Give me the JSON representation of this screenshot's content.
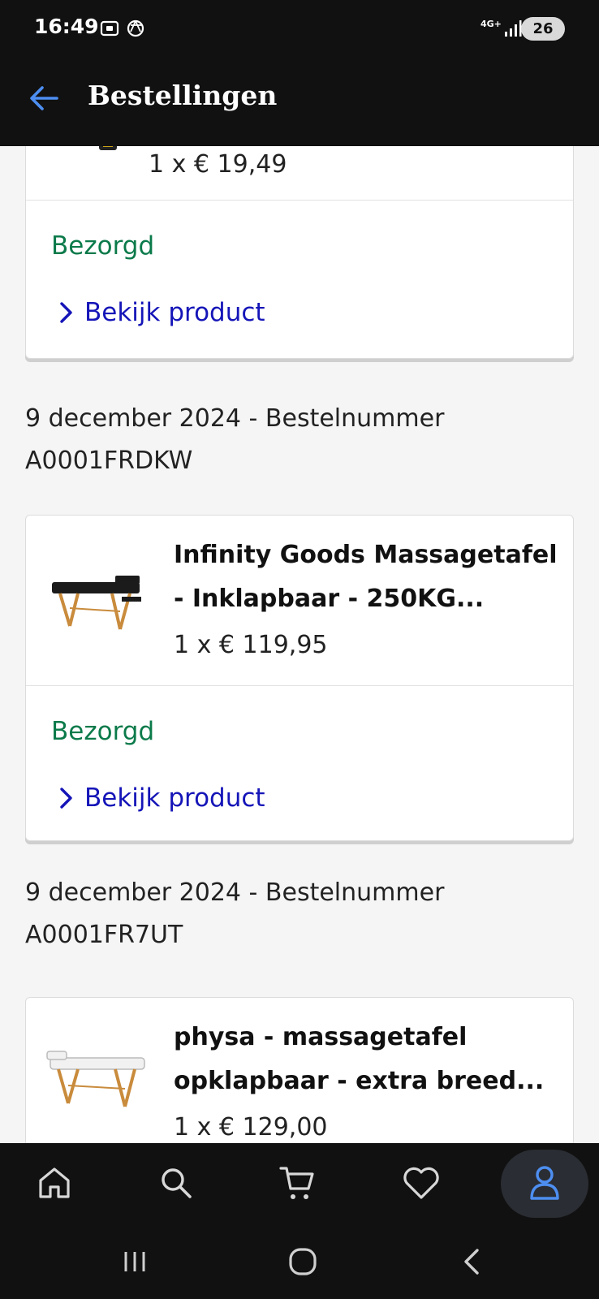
{
  "status_bar": {
    "time": "16:49",
    "network": "4G+",
    "battery": "26",
    "icons": [
      "screenshot-icon",
      "openai-icon",
      "signal-icon"
    ]
  },
  "app_bar": {
    "title": "Bestellingen",
    "back_icon": "arrow-left-icon"
  },
  "orders": [
    {
      "heading": "",
      "item": {
        "name": "",
        "price": "1 x € 19,49",
        "status": "Bezorgd",
        "link": "Bekijk product"
      }
    },
    {
      "heading_date": "9 december 2024 - Bestelnummer",
      "heading_number": "A0001FRDKW",
      "item": {
        "name_line1": "Infinity Goods Massagetafel",
        "name_line2": "- Inklapbaar - 250KG...",
        "price": "1 x € 119,95",
        "status": "Bezorgd",
        "link": "Bekijk product"
      }
    },
    {
      "heading_date": "9 december 2024 - Bestelnummer",
      "heading_number": "A0001FR7UT",
      "item": {
        "name_line1": "physa - massagetafel",
        "name_line2": "opklapbaar - extra breed...",
        "price": "1 x € 129,00"
      }
    }
  ],
  "bottom_nav": [
    {
      "icon": "home-icon",
      "active": false
    },
    {
      "icon": "search-icon",
      "active": false
    },
    {
      "icon": "cart-icon",
      "active": false
    },
    {
      "icon": "heart-icon",
      "active": false
    },
    {
      "icon": "account-icon",
      "active": true
    }
  ],
  "colors": {
    "status_green": "#0b7a4a",
    "link_blue": "#1515b8",
    "accent_blue": "#4d8ef0",
    "bar_black": "#111111"
  }
}
